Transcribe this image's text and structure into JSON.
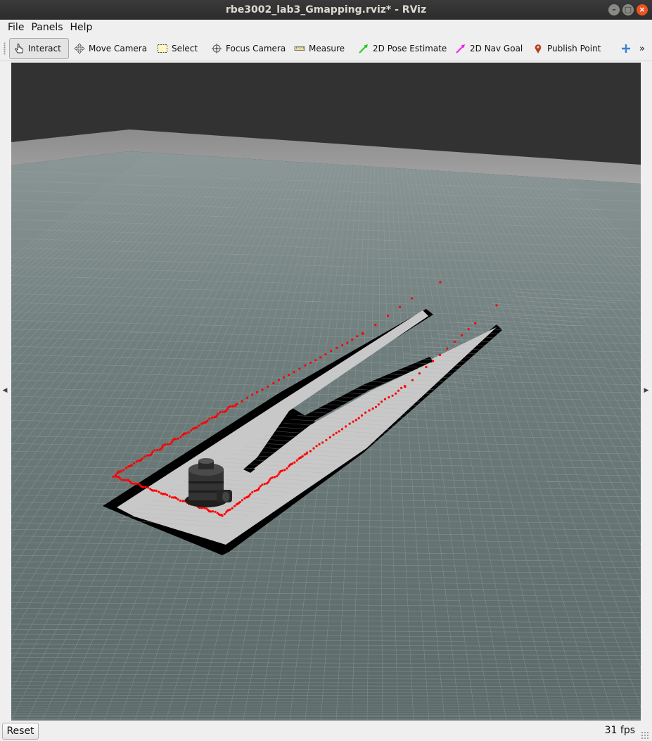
{
  "window": {
    "title": "rbe3002_lab3_Gmapping.rviz* - RViz"
  },
  "menu": {
    "file": "File",
    "panels": "Panels",
    "help": "Help"
  },
  "toolbar": {
    "interact": "Interact",
    "move_camera": "Move Camera",
    "select": "Select",
    "focus_camera": "Focus Camera",
    "measure": "Measure",
    "pose_estimate": "2D Pose Estimate",
    "nav_goal": "2D Nav Goal",
    "publish_point": "Publish Point",
    "overflow": "»"
  },
  "colors": {
    "pose_estimate": "#22cc22",
    "nav_goal": "#ee22ee",
    "publish_point": "#b34020",
    "laser": "#ff0000",
    "free_space": "#c8c8c8",
    "occupied": "#000000"
  },
  "status": {
    "reset": "Reset",
    "fps": "31 fps"
  }
}
